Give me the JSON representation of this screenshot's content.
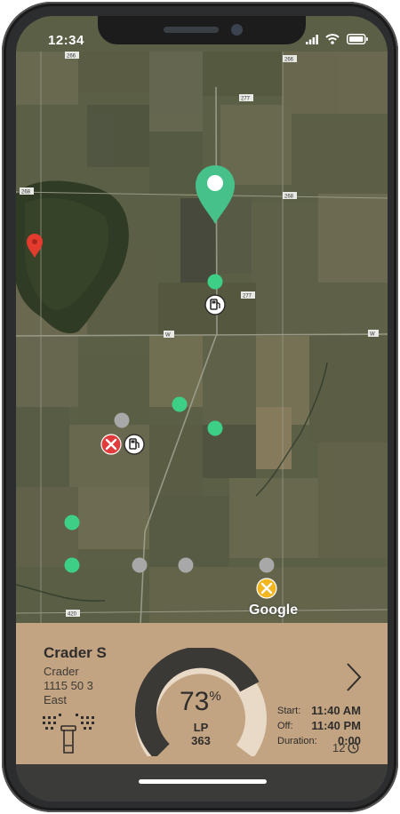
{
  "status_bar": {
    "time": "12:34"
  },
  "map": {
    "road_labels": [
      "266",
      "266",
      "277",
      "268",
      "268",
      "277",
      "W",
      "W",
      "420"
    ],
    "attribution": "Google"
  },
  "colors": {
    "panel_bg": "#c2a382",
    "pin_green": "#47c18a",
    "pin_red": "#e33b2e",
    "dot_green": "#3ecf86",
    "dot_gray": "#a8a8a8",
    "gauge_dark": "#3b3936",
    "gauge_light": "#e9dac7"
  },
  "icons": [
    "map-pin-icon",
    "fuel-pump-icon",
    "repair-tools-icon",
    "warning-tools-icon",
    "sprinkler-icon",
    "chevron-right-icon",
    "clock-icon",
    "signal-icon",
    "wifi-icon",
    "battery-icon"
  ],
  "panel": {
    "name": "Crader S",
    "location": "Crader",
    "number": "1115 50 3",
    "direction": "East",
    "gauge": {
      "percent": "73",
      "percent_sign": "%",
      "percent_value": 0.73,
      "type": "LP",
      "amount": "363"
    },
    "schedule": {
      "start_label": "Start:",
      "start_value": "11:40 AM",
      "off_label": "Off:",
      "off_value": "11:40 PM",
      "duration_label": "Duration:",
      "duration_value": "0:00"
    },
    "count": "12"
  }
}
